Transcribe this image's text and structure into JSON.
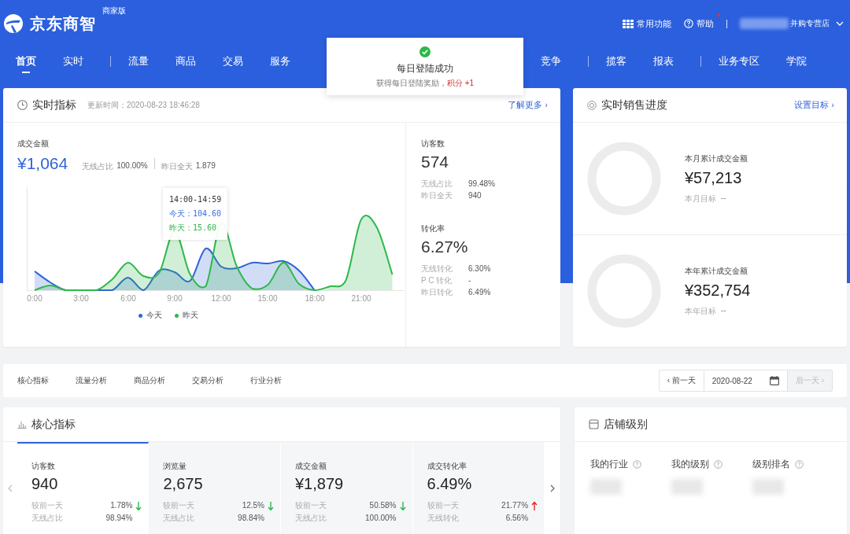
{
  "header": {
    "logo": "京东商智",
    "edition": "商家版",
    "actions": [
      {
        "kind": "grid",
        "label": "常用功能"
      },
      {
        "kind": "help",
        "label": "帮助",
        "notice": true
      }
    ],
    "store": "并购专营店"
  },
  "nav": [
    {
      "label": "首页",
      "selected": true,
      "divider_after": false
    },
    {
      "label": "实时",
      "selected": false,
      "divider_after": true
    },
    {
      "label": "流量",
      "selected": false,
      "divider_after": false
    },
    {
      "label": "商品",
      "selected": false,
      "divider_after": false
    },
    {
      "label": "交易",
      "selected": false,
      "divider_after": false
    },
    {
      "label": "服务",
      "selected": false,
      "divider_after": false
    },
    {
      "label": "竞争",
      "selected": false,
      "divider_after": true,
      "gap_before": true
    },
    {
      "label": "揽客",
      "selected": false,
      "divider_after": false
    },
    {
      "label": "报表",
      "selected": false,
      "divider_after": true
    },
    {
      "label": "业务专区",
      "selected": false,
      "divider_after": false
    },
    {
      "label": "学院",
      "selected": false,
      "divider_after": false
    }
  ],
  "toast": {
    "title": "每日登陆成功",
    "message": "获得每日登陆奖励，",
    "reward": "积分 +1"
  },
  "realtime": {
    "title": "实时指标",
    "updated": "更新时间：2020-08-23 18:46:28",
    "link": "了解更多 ›",
    "main": {
      "label": "成交金额",
      "value": "¥1,064",
      "stats": [
        {
          "label": "无线占比",
          "value": "100.00%"
        },
        {
          "label": "昨日全天",
          "value": "1.879"
        }
      ]
    },
    "chart": {
      "x_labels": [
        "0:00",
        "3:00",
        "6:00",
        "9:00",
        "12:00",
        "15:00",
        "18:00",
        "21:00"
      ],
      "tooltip": {
        "time": "14:00-14:59",
        "rows": [
          {
            "text": "今天：104.60",
            "color": "#3b6fe0"
          },
          {
            "text": "昨天：15.60",
            "color": "#2db84a"
          }
        ]
      },
      "legend": [
        {
          "label": "今天",
          "color": "#2f64d8"
        },
        {
          "label": "昨天",
          "color": "#2db84a"
        }
      ]
    },
    "side": [
      {
        "label": "访客数",
        "value": "574",
        "rows": [
          {
            "label": "无线占比",
            "value": "99.48%"
          },
          {
            "label": "昨日全天",
            "value": "940"
          }
        ]
      },
      {
        "label": "转化率",
        "value": "6.27%",
        "rows": [
          {
            "label": "无线转化",
            "value": "6.30%"
          },
          {
            "label": "P C 转化",
            "value": "-"
          },
          {
            "label": "昨日转化",
            "value": "6.49%"
          }
        ]
      }
    ]
  },
  "sales": {
    "title": "实时销售进度",
    "link": "设置目标 ›",
    "items": [
      {
        "label": "本月累计成交金额",
        "value": "¥57,213",
        "target_label": "本月目标",
        "target": "--"
      },
      {
        "label": "本年累计成交金额",
        "value": "¥352,754",
        "target_label": "本年目标",
        "target": "--"
      }
    ]
  },
  "tabs": {
    "items": [
      {
        "label": "核心指标",
        "selected": false
      },
      {
        "label": "流量分析",
        "selected": false
      },
      {
        "label": "商品分析",
        "selected": false
      },
      {
        "label": "交易分析",
        "selected": false
      },
      {
        "label": "行业分析",
        "selected": false
      }
    ],
    "date_nav": {
      "prev": "‹ 前一天",
      "date": "2020-08-22",
      "next": "后一天 ›",
      "next_disabled": true
    }
  },
  "core": {
    "title": "核心指标",
    "cards": [
      {
        "label": "访客数",
        "value": "940",
        "selected": true,
        "rows": [
          {
            "label": "较前一天",
            "value": "1.78%",
            "rising": false
          },
          {
            "label": "无线占比",
            "value": "98.94%"
          }
        ]
      },
      {
        "label": "浏览量",
        "value": "2,675",
        "selected": false,
        "rows": [
          {
            "label": "较前一天",
            "value": "12.5%",
            "rising": false
          },
          {
            "label": "无线占比",
            "value": "98.84%"
          }
        ]
      },
      {
        "label": "成交金额",
        "value": "¥1,879",
        "selected": false,
        "rows": [
          {
            "label": "较前一天",
            "value": "50.58%",
            "rising": false
          },
          {
            "label": "无线占比",
            "value": "100.00%"
          }
        ]
      },
      {
        "label": "成交转化率",
        "value": "6.49%",
        "selected": false,
        "rows": [
          {
            "label": "较前一天",
            "value": "21.77%",
            "rising": true
          },
          {
            "label": "无线转化",
            "value": "6.56%"
          }
        ]
      }
    ]
  },
  "level": {
    "title": "店铺级别",
    "columns": [
      "我的行业",
      "我的级别",
      "级别排名"
    ]
  }
}
